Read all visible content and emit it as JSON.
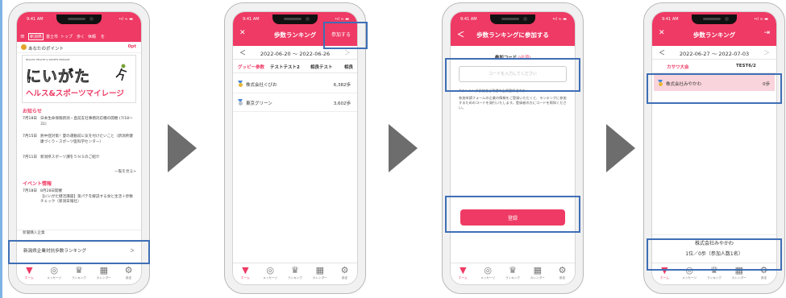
{
  "phone1": {
    "status_time": "9:41 AM",
    "status_signal": "•ıl ≈ ▬",
    "menu_items": [
      "新潟県",
      "富士市",
      "トップ",
      "歩く",
      "休暇",
      "を"
    ],
    "points_label": "あなたのポイント",
    "points_value": "0pt",
    "banner_small": "NIIGATA HEALTH & SPORTS MILEAGE",
    "banner_main": "にいがた",
    "banner_sub": "ヘルス&スポーツマイレージ",
    "news_title": "お知らせ",
    "news": [
      {
        "date": "7月18日",
        "text": "日本生命保険新潟・直前支社事務対応機の開催 (7/18〜31)"
      },
      {
        "date": "7月15日",
        "text": "熱中症対策！夏の運動前に気を付けたいこと（新潟県健康づくり・スポーツ医科学センター）"
      },
      {
        "date": "7月11日",
        "text": "新潟県スポーツ課を５ＮＳのご紹介"
      }
    ],
    "news_more": "一覧を見る>",
    "event_title": "イベント情報",
    "event_date": "7月18日",
    "event_line1": "8月28日開催",
    "event_line2": "【にいがた健活講座】第パテを解説する食と生活＋歩数チェック（新潟日報社）",
    "misc_row": "新聞購入企業",
    "ranking_item": "新潟県企業対抗歩数ランキング",
    "ranking_chevron": "＞",
    "tabs": [
      {
        "icon": "▼",
        "label": "ホーム"
      },
      {
        "icon": "◎",
        "label": "メッセージ"
      },
      {
        "icon": "♛",
        "label": "ランキング"
      },
      {
        "icon": "▦",
        "label": "カレンダー"
      },
      {
        "icon": "⚙",
        "label": "設定"
      }
    ]
  },
  "phone2": {
    "status_time": "9:41 AM",
    "status_signal": "•ıl ≈ ▬",
    "close": "✕",
    "title": "歩数ランキング",
    "join_button": "参加する",
    "date_range": "2022-06-20 〜 2022-06-26",
    "prev": "＜",
    "next": "＞",
    "segments": [
      "グッピー参数",
      "テストテスト2",
      "相良テスト",
      "相良"
    ],
    "rows": [
      {
        "name": "株式会社ぐびお",
        "steps": "6,382歩"
      },
      {
        "name": "東京グリーン",
        "steps": "3,602歩"
      }
    ],
    "tabs": [
      {
        "icon": "▼",
        "label": "ホーム"
      },
      {
        "icon": "◎",
        "label": "メッセージ"
      },
      {
        "icon": "♛",
        "label": "ランキング"
      },
      {
        "icon": "▦",
        "label": "カレンダー"
      },
      {
        "icon": "⚙",
        "label": "設定"
      }
    ]
  },
  "phone3": {
    "status_time": "9:41 AM",
    "status_signal": "•ıl ≈ ▬",
    "back": "＜",
    "title": "歩数ランキングに参加する",
    "code_label": "参加コード",
    "code_required": "(必須)",
    "code_placeholder": "コードを入力してください",
    "note1": "※ランキング参加者ご希望の企業登録者のかへ",
    "note2": "参加申請フォームの企業の情報をご登録いただくと、ランキングに参加するためのコードを発行いたします。登録者の方にコードを周知ください。",
    "register_button": "登録",
    "tabs": [
      {
        "icon": "▼",
        "label": "ホーム"
      },
      {
        "icon": "◎",
        "label": "メッセージ"
      },
      {
        "icon": "♛",
        "label": "ランキング"
      },
      {
        "icon": "▦",
        "label": "カレンダー"
      },
      {
        "icon": "⚙",
        "label": "設定"
      }
    ]
  },
  "phone4": {
    "status_time": "9:41 AM",
    "status_signal": "•ıl ≈ ▬",
    "close": "✕",
    "title": "歩数ランキング",
    "exit_icon": "⇥",
    "date_range": "2022-06-27 〜 2022-07-03",
    "prev": "＜",
    "next": "＞",
    "segments": [
      "カサワ大会",
      "TEST6/2"
    ],
    "row": {
      "name": "株式会社みやかわ",
      "steps": "0歩"
    },
    "footer_company": "株式会社みやかわ",
    "footer_rank": "1位／0歩（参加人数1名）",
    "tabs": [
      {
        "icon": "▼",
        "label": "ホーム"
      },
      {
        "icon": "◎",
        "label": "メッセージ"
      },
      {
        "icon": "♛",
        "label": "ランキング"
      },
      {
        "icon": "▦",
        "label": "カレンダー"
      },
      {
        "icon": "⚙",
        "label": "設定"
      }
    ]
  },
  "colors": {
    "accent": "#ee3a64",
    "highlight": "#3f6fb6",
    "arrow": "#6d6d6d"
  }
}
